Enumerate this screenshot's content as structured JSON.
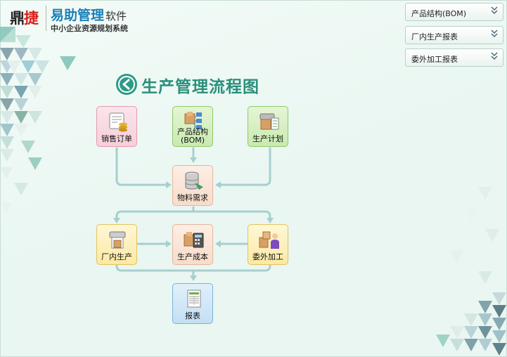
{
  "brand": {
    "mark_left": "鼎",
    "mark_right": "捷",
    "name": "易助管理",
    "name_suffix": "软件",
    "subtitle": "中小企业资源规划系统"
  },
  "side_panels": [
    {
      "label": "产品结构(BOM)",
      "icon": "chevron-down-double-icon"
    },
    {
      "label": "厂内生产报表",
      "icon": "chevron-down-double-icon"
    },
    {
      "label": "委外加工报表",
      "icon": "chevron-down-double-icon"
    }
  ],
  "flow": {
    "title": "生产管理流程图",
    "back_icon": "back-arrow-icon",
    "nodes": {
      "sales_order": {
        "label": "销售订单",
        "icon": "sales-order-icon"
      },
      "bom": {
        "label_line1": "产品结构",
        "label_line2": "(BOM)",
        "icon": "product-structure-icon"
      },
      "production_plan": {
        "label": "生产计划",
        "icon": "production-plan-icon"
      },
      "material_req": {
        "label": "物料需求",
        "icon": "material-requirement-icon"
      },
      "in_house": {
        "label": "厂内生产",
        "icon": "in-house-production-icon"
      },
      "cost": {
        "label": "生产成本",
        "icon": "production-cost-icon"
      },
      "outsource": {
        "label": "委外加工",
        "icon": "outsourcing-icon"
      },
      "report": {
        "label": "报表",
        "icon": "report-icon"
      }
    }
  },
  "colors": {
    "accent": "#2b8f7c",
    "connector": "#a7cfd0",
    "brand_blue": "#1a7fb8",
    "brand_red": "#d91e18"
  }
}
